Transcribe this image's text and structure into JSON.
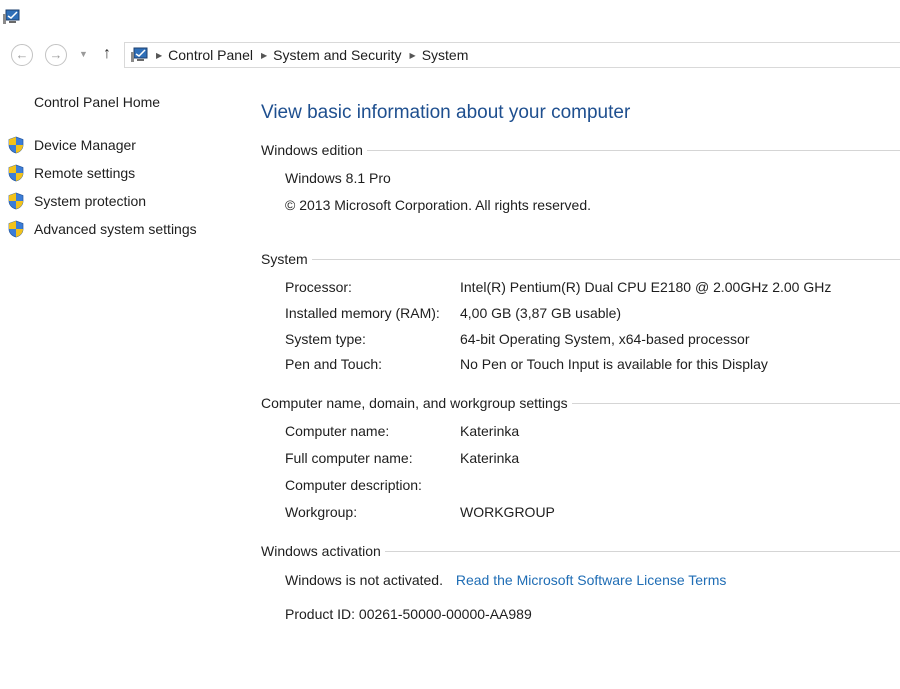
{
  "breadcrumb": [
    "Control Panel",
    "System and Security",
    "System"
  ],
  "sidebar": {
    "home": "Control Panel Home",
    "links": [
      "Device Manager",
      "Remote settings",
      "System protection",
      "Advanced system settings"
    ]
  },
  "main": {
    "title": "View basic information about your computer",
    "edition": {
      "heading": "Windows edition",
      "name": "Windows 8.1 Pro",
      "copyright": "© 2013 Microsoft Corporation. All rights reserved."
    },
    "system": {
      "heading": "System",
      "rows": [
        {
          "label": "Processor:",
          "value": "Intel(R) Pentium(R) Dual  CPU  E2180  @ 2.00GHz   2.00 GHz"
        },
        {
          "label": "Installed memory (RAM):",
          "value": "4,00 GB (3,87 GB usable)"
        },
        {
          "label": "System type:",
          "value": "64-bit Operating System, x64-based processor"
        },
        {
          "label": "Pen and Touch:",
          "value": "No Pen or Touch Input is available for this Display"
        }
      ]
    },
    "computer": {
      "heading": "Computer name, domain, and workgroup settings",
      "rows": [
        {
          "label": "Computer name:",
          "value": "Katerinka"
        },
        {
          "label": "Full computer name:",
          "value": "Katerinka"
        },
        {
          "label": "Computer description:",
          "value": ""
        },
        {
          "label": "Workgroup:",
          "value": "WORKGROUP"
        }
      ]
    },
    "activation": {
      "heading": "Windows activation",
      "status": "Windows is not activated.",
      "license_link": "Read the Microsoft Software License Terms",
      "product_id": "Product ID:  00261-50000-00000-AA989"
    }
  },
  "icons": {
    "app": "system-computer-icon",
    "back": "back-arrow-icon",
    "forward": "forward-arrow-icon",
    "up": "up-arrow-icon",
    "shield": "uac-shield-icon"
  },
  "colors": {
    "title": "#1e4f8f",
    "link": "#1f6db5",
    "rule": "#d5d5d5"
  }
}
